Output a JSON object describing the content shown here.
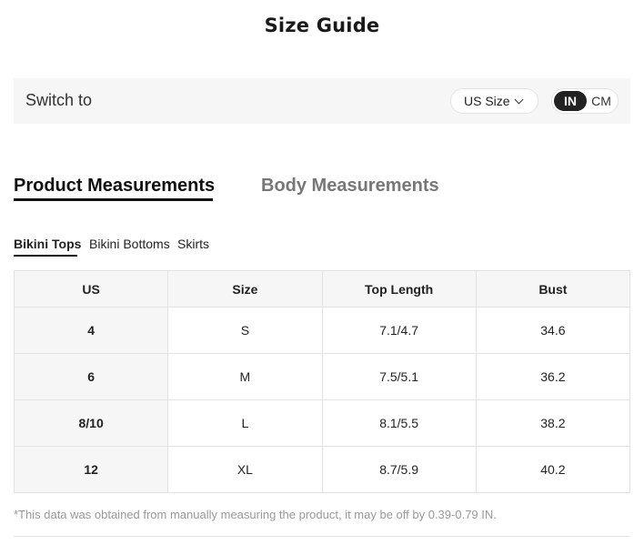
{
  "title": "Size Guide",
  "switch": {
    "label": "Switch to",
    "size_select": "US Size",
    "units": [
      "IN",
      "CM"
    ],
    "active_unit": "IN"
  },
  "main_tabs": [
    {
      "label": "Product Measurements",
      "active": true
    },
    {
      "label": "Body Measurements",
      "active": false
    }
  ],
  "sub_tabs": [
    {
      "label": "Bikini Tops",
      "active": true
    },
    {
      "label": "Bikini Bottoms",
      "active": false
    },
    {
      "label": "Skirts",
      "active": false
    }
  ],
  "table": {
    "headers": [
      "US",
      "Size",
      "Top Length",
      "Bust"
    ],
    "rows": [
      [
        "4",
        "S",
        "7.1/4.7",
        "34.6"
      ],
      [
        "6",
        "M",
        "7.5/5.1",
        "36.2"
      ],
      [
        "8/10",
        "L",
        "8.1/5.5",
        "38.2"
      ],
      [
        "12",
        "XL",
        "8.7/5.9",
        "40.2"
      ]
    ]
  },
  "note": "*This data was obtained from manually measuring the product, it may be off by 0.39-0.79 IN.",
  "colors": {
    "panel_bg": "#f6f6f6",
    "active_unit_bg": "#222222",
    "note_text": "#999999"
  },
  "icons": {
    "size_select": "chevron-down-icon"
  }
}
